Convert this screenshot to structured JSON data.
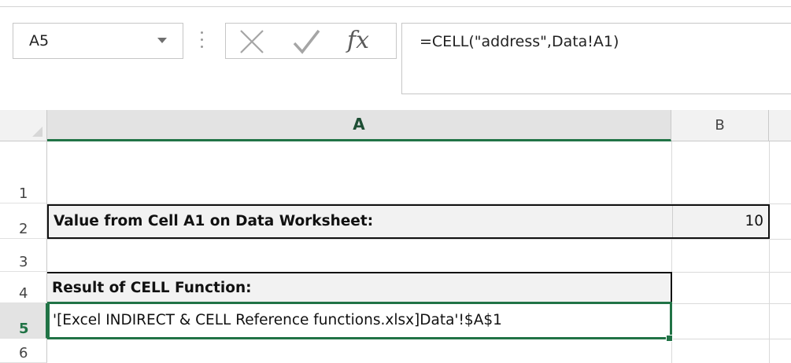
{
  "formula_bar": {
    "name_box": "A5",
    "formula": "=CELL(\"address\",Data!A1)",
    "fx_label": "fx"
  },
  "columns": [
    "A",
    "B"
  ],
  "rows": [
    "1",
    "2",
    "3",
    "4",
    "5",
    "6"
  ],
  "active_row": "5",
  "cells": {
    "A2": "Value from Cell A1 on Data Worksheet:",
    "B2": "10",
    "A4": "Result of CELL Function:",
    "A5": "'[Excel INDIRECT & CELL Reference functions.xlsx]Data'!$A$1"
  },
  "colors": {
    "selection_accent": "#217346",
    "header_bg": "#e3e3e3",
    "cell_fill": "#f2f2f2"
  },
  "icons": [
    "chevron-down-icon",
    "more-dots-icon",
    "cancel-x-icon",
    "enter-check-icon",
    "insert-function-icon"
  ]
}
